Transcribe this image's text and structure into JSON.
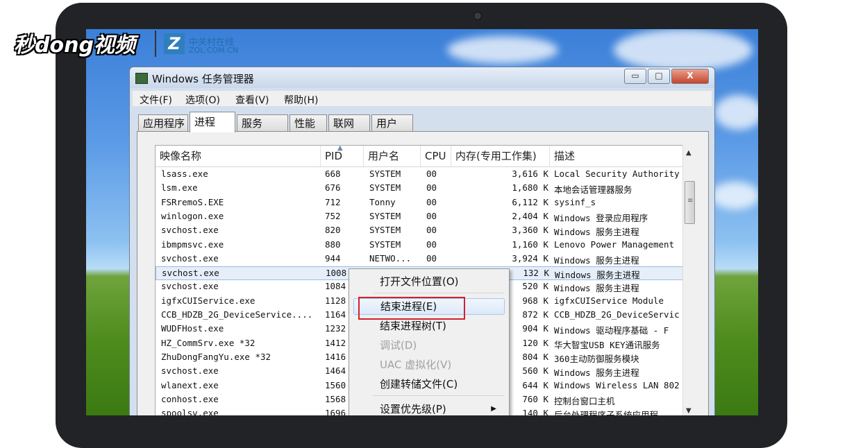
{
  "brand": {
    "watermark_text": "秒dong视频",
    "zol_logo_letter": "Z",
    "zol_cn": "中关村在线",
    "zol_en": "ZOL.COM.CN"
  },
  "window": {
    "title": "Windows 任务管理器",
    "controls": {
      "minimize": "▭",
      "maximize": "□",
      "close": "X"
    }
  },
  "menubar": [
    "文件(F)",
    "选项(O)",
    "查看(V)",
    "帮助(H)"
  ],
  "tabs": [
    {
      "label": "应用程序",
      "active": false
    },
    {
      "label": "进程",
      "active": true
    },
    {
      "label": "服务",
      "active": false
    },
    {
      "label": "性能",
      "active": false
    },
    {
      "label": "联网",
      "active": false
    },
    {
      "label": "用户",
      "active": false
    }
  ],
  "columns": [
    "映像名称",
    "PID",
    "用户名",
    "CPU",
    "内存(专用工作集)",
    "描述"
  ],
  "rows": [
    {
      "name": "lsass.exe",
      "pid": "668",
      "user": "SYSTEM",
      "cpu": "00",
      "mem": "3,616 K",
      "desc": "Local Security Authority"
    },
    {
      "name": "lsm.exe",
      "pid": "676",
      "user": "SYSTEM",
      "cpu": "00",
      "mem": "1,680 K",
      "desc": "本地会话管理器服务"
    },
    {
      "name": "FSRremoS.EXE",
      "pid": "712",
      "user": "Tonny",
      "cpu": "00",
      "mem": "6,112 K",
      "desc": "sysinf_s"
    },
    {
      "name": "winlogon.exe",
      "pid": "752",
      "user": "SYSTEM",
      "cpu": "00",
      "mem": "2,404 K",
      "desc": "Windows 登录应用程序"
    },
    {
      "name": "svchost.exe",
      "pid": "820",
      "user": "SYSTEM",
      "cpu": "00",
      "mem": "3,360 K",
      "desc": "Windows 服务主进程"
    },
    {
      "name": "ibmpmsvc.exe",
      "pid": "880",
      "user": "SYSTEM",
      "cpu": "00",
      "mem": "1,160 K",
      "desc": "Lenovo Power Management"
    },
    {
      "name": "svchost.exe",
      "pid": "944",
      "user": "NETWO...",
      "cpu": "00",
      "mem": "3,924 K",
      "desc": "Windows 服务主进程"
    },
    {
      "name": "svchost.exe",
      "pid": "1008",
      "user": "",
      "cpu": "",
      "mem": "132 K",
      "desc": "Windows 服务主进程"
    },
    {
      "name": "svchost.exe",
      "pid": "1084",
      "user": "",
      "cpu": "",
      "mem": "520 K",
      "desc": "Windows 服务主进程"
    },
    {
      "name": "igfxCUIService.exe",
      "pid": "1128",
      "user": "",
      "cpu": "",
      "mem": "968 K",
      "desc": "igfxCUIService Module"
    },
    {
      "name": "CCB_HDZB_2G_DeviceService....",
      "pid": "1164",
      "user": "",
      "cpu": "",
      "mem": "872 K",
      "desc": "CCB_HDZB_2G_DeviceServic"
    },
    {
      "name": "WUDFHost.exe",
      "pid": "1232",
      "user": "",
      "cpu": "",
      "mem": "904 K",
      "desc": "Windows 驱动程序基础 - F"
    },
    {
      "name": "HZ_CommSrv.exe *32",
      "pid": "1412",
      "user": "",
      "cpu": "",
      "mem": "120 K",
      "desc": "华大智宝USB KEY通讯服务"
    },
    {
      "name": "ZhuDongFangYu.exe *32",
      "pid": "1416",
      "user": "",
      "cpu": "",
      "mem": "804 K",
      "desc": "360主动防御服务模块"
    },
    {
      "name": "svchost.exe",
      "pid": "1464",
      "user": "",
      "cpu": "",
      "mem": "560 K",
      "desc": "Windows 服务主进程"
    },
    {
      "name": "wlanext.exe",
      "pid": "1560",
      "user": "",
      "cpu": "",
      "mem": "644 K",
      "desc": "Windows Wireless LAN 802"
    },
    {
      "name": "conhost.exe",
      "pid": "1568",
      "user": "",
      "cpu": "",
      "mem": "760 K",
      "desc": "控制台窗口主机"
    },
    {
      "name": "spoolsv.exe",
      "pid": "1696",
      "user": "",
      "cpu": "",
      "mem": "140 K",
      "desc": "后台处理程序子系统应用程"
    }
  ],
  "context_menu": [
    {
      "label": "打开文件位置(O)",
      "disabled": false
    },
    {
      "label": "结束进程(E)",
      "disabled": false
    },
    {
      "label": "结束进程树(T)",
      "disabled": false
    },
    {
      "label": "调试(D)",
      "disabled": true
    },
    {
      "label": "UAC 虚拟化(V)",
      "disabled": true
    },
    {
      "label": "创建转储文件(C)",
      "disabled": false
    },
    {
      "label": "设置优先级(P)",
      "disabled": false
    }
  ]
}
